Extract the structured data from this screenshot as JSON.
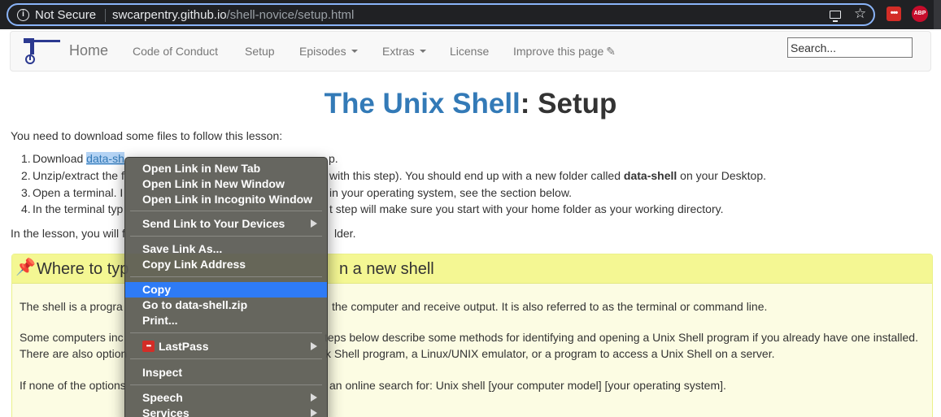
{
  "browser": {
    "security_status": "Not Secure",
    "url_host": "swcarpentry.github.io",
    "url_path": "/shell-novice/setup.html",
    "extensions": {
      "lastpass_label": "•••",
      "abp_label": "ABP"
    }
  },
  "navbar": {
    "home": "Home",
    "code_of_conduct": "Code of Conduct",
    "setup": "Setup",
    "episodes": "Episodes",
    "extras": "Extras",
    "license": "License",
    "improve": "Improve this page",
    "search_placeholder": "Search..."
  },
  "page": {
    "title_accent": "The Unix Shell",
    "title_rest": ": Setup",
    "intro": "You need to download some files to follow this lesson:",
    "steps": [
      {
        "num": "1.",
        "prefix": "Download ",
        "link": "data-sh",
        "suffix": "p.",
        "tail": ""
      },
      {
        "num": "2.",
        "prefix": "Unzip/extract the f",
        "suffix": "with this step). You should end up with a new folder called ",
        "bold": "data-shell",
        "tail": " on your Desktop."
      },
      {
        "num": "3.",
        "prefix": "Open a terminal. I",
        "suffix": "in your operating system, see the section below.",
        "tail": ""
      },
      {
        "num": "4.",
        "prefix": "In the terminal typ",
        "suffix": "t step will make sure you start with your home folder as your working directory.",
        "tail": ""
      }
    ],
    "lesson_note_prefix": "In the lesson, you will f",
    "lesson_note_suffix": "lder."
  },
  "callout": {
    "title_prefix": "Where to typ",
    "title_suffix": "n a new shell",
    "para1_prefix": "The shell is a progra",
    "para1_suffix": "the computer and receive output. It is also referred to as the terminal or command line.",
    "para2_line1_prefix": "Some computers inc",
    "para2_line1_suffix": "teps below describe some methods for identifying and opening a Unix Shell program if you already have one installed.",
    "para2_line2_prefix": "There are also option",
    "para2_line2_suffix": "k Shell program, a Linux/UNIX emulator, or a program to access a Unix Shell on a server.",
    "para3_prefix": "If none of the options",
    "para3_suffix": "an online search for: Unix shell [your computer model] [your operating system]."
  },
  "context_menu": {
    "open_new_tab": "Open Link in New Tab",
    "open_new_window": "Open Link in New Window",
    "open_incognito": "Open Link in Incognito Window",
    "send_to_devices": "Send Link to Your Devices",
    "save_link_as": "Save Link As...",
    "copy_link_address": "Copy Link Address",
    "copy": "Copy",
    "go_to": "Go to data-shell.zip",
    "print": "Print...",
    "lastpass": "LastPass",
    "inspect": "Inspect",
    "speech": "Speech",
    "services": "Services"
  },
  "colors": {
    "link": "#337ab7",
    "highlight": "#2e7bf6",
    "callout_bg": "#fcfce3",
    "callout_head": "#f4f793",
    "lastpass_red": "#d32d27"
  }
}
